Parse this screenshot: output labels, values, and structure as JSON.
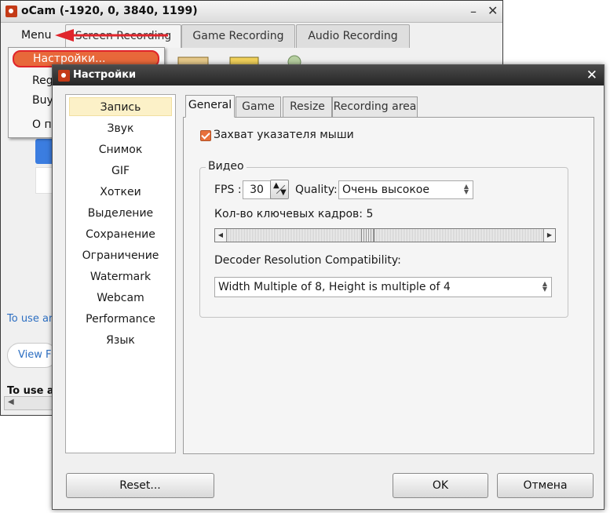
{
  "background_window": {
    "title": "oCam (-1920, 0, 3840, 1199)",
    "menu_label": "Menu",
    "tabs": [
      "Screen Recording",
      "Game Recording",
      "Audio Recording"
    ],
    "dropdown_items": [
      "Настройки...",
      "Reg",
      "Buy",
      "О п"
    ],
    "link_text": "To use ar",
    "view_button": "View F",
    "bold_text": "To use ar"
  },
  "dialog": {
    "title": "Настройки",
    "categories": [
      "Запись",
      "Звук",
      "Снимок",
      "GIF",
      "Хоткеи",
      "Выделение",
      "Сохранение",
      "Ограничение",
      "Watermark",
      "Webcam",
      "Performance",
      "Язык"
    ],
    "selected_category": "Запись",
    "tabs": [
      "General",
      "Game",
      "Resize",
      "Recording area"
    ],
    "active_tab": "General",
    "mouse_capture": {
      "label": "Захват указателя мыши",
      "checked": true
    },
    "video_group": {
      "title": "Видео",
      "fps_label": "FPS :",
      "fps_value": "30",
      "quality_label": "Quality:",
      "quality_value": "Очень высокое",
      "keyframes_label": "Кол-во ключевых кадров: 5",
      "decoder_label": "Decoder Resolution Compatibility:",
      "decoder_value": "Width Multiple of 8, Height is multiple of 4"
    },
    "buttons": {
      "reset": "Reset...",
      "ok": "OK",
      "cancel": "Отмена"
    }
  },
  "colors": {
    "accent_orange": "#e8683a",
    "highlight_red": "#e0242b",
    "selected_category_bg": "#fcf1c8",
    "dialog_titlebar": "#262626"
  }
}
